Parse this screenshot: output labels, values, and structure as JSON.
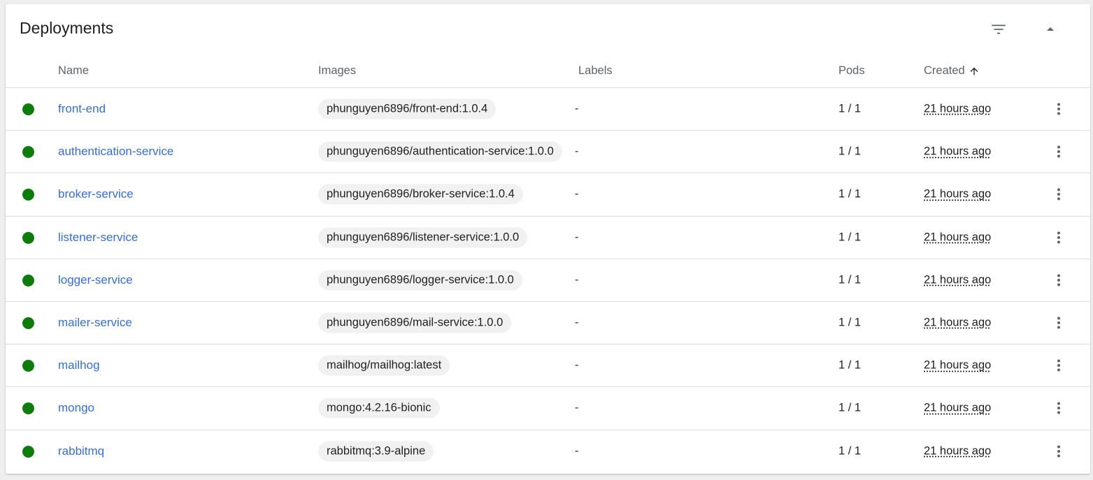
{
  "card": {
    "title": "Deployments",
    "filter_icon": "filter-list-icon",
    "collapse_icon": "arrow-drop-up-icon"
  },
  "columns": {
    "name": "Name",
    "images": "Images",
    "labels": "Labels",
    "pods": "Pods",
    "created": "Created",
    "created_sort_icon": "arrow-upward-icon"
  },
  "colors": {
    "status_ok": "#0b7d0b",
    "link": "#326de6",
    "chip_bg": "#f1f1f1"
  },
  "rows": [
    {
      "name": "front-end",
      "image": "phunguyen6896/front-end:1.0.4",
      "labels": "-",
      "pods": "1 / 1",
      "created": "21 hours ago"
    },
    {
      "name": "authentication-service",
      "image": "phunguyen6896/authentication-service:1.0.0",
      "labels": "-",
      "pods": "1 / 1",
      "created": "21 hours ago"
    },
    {
      "name": "broker-service",
      "image": "phunguyen6896/broker-service:1.0.4",
      "labels": "-",
      "pods": "1 / 1",
      "created": "21 hours ago"
    },
    {
      "name": "listener-service",
      "image": "phunguyen6896/listener-service:1.0.0",
      "labels": "-",
      "pods": "1 / 1",
      "created": "21 hours ago"
    },
    {
      "name": "logger-service",
      "image": "phunguyen6896/logger-service:1.0.0",
      "labels": "-",
      "pods": "1 / 1",
      "created": "21 hours ago"
    },
    {
      "name": "mailer-service",
      "image": "phunguyen6896/mail-service:1.0.0",
      "labels": "-",
      "pods": "1 / 1",
      "created": "21 hours ago"
    },
    {
      "name": "mailhog",
      "image": "mailhog/mailhog:latest",
      "labels": "-",
      "pods": "1 / 1",
      "created": "21 hours ago"
    },
    {
      "name": "mongo",
      "image": "mongo:4.2.16-bionic",
      "labels": "-",
      "pods": "1 / 1",
      "created": "21 hours ago"
    },
    {
      "name": "rabbitmq",
      "image": "rabbitmq:3.9-alpine",
      "labels": "-",
      "pods": "1 / 1",
      "created": "21 hours ago"
    }
  ]
}
